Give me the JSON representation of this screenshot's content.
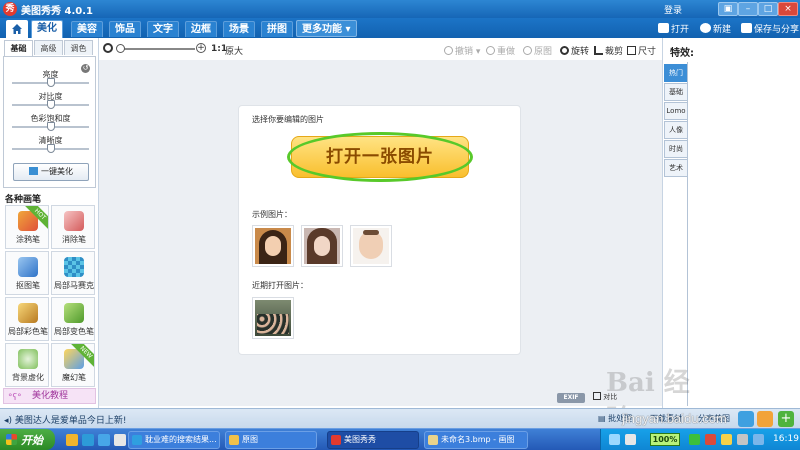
{
  "app": {
    "title": "美图秀秀 4.0.1",
    "login": "登录"
  },
  "main_tabs": [
    {
      "label": "美化",
      "active": true
    },
    {
      "label": "美容"
    },
    {
      "label": "饰品"
    },
    {
      "label": "文字"
    },
    {
      "label": "边框"
    },
    {
      "label": "场景"
    },
    {
      "label": "拼图"
    }
  ],
  "more_tab": "更多功能 ▾",
  "top_actions": {
    "open": "打开",
    "new": "新建",
    "save_share": "保存与分享"
  },
  "toolbar": {
    "ratio": "1:1",
    "original_size": "原大",
    "undo": "撤销",
    "redo": "重做",
    "original": "原图",
    "rotate": "旋转",
    "crop": "裁剪",
    "size": "尺寸"
  },
  "left_panel": {
    "sub_tabs": [
      {
        "label": "基础",
        "active": true
      },
      {
        "label": "高级"
      },
      {
        "label": "调色"
      }
    ],
    "sliders": [
      {
        "label": "亮度",
        "value": 0.5
      },
      {
        "label": "对比度",
        "value": 0.5
      },
      {
        "label": "色彩饱和度",
        "value": 0.5
      },
      {
        "label": "清晰度",
        "value": 0.5
      }
    ],
    "one_click": "一键美化",
    "brush_title": "各种画笔",
    "brushes": [
      {
        "label": "涂鸦笔",
        "badge": ""
      },
      {
        "label": "消除笔",
        "badge": ""
      },
      {
        "label": "抠图笔",
        "badge": ""
      },
      {
        "label": "局部马赛克",
        "badge": ""
      },
      {
        "label": "局部彩色笔",
        "badge": ""
      },
      {
        "label": "局部变色笔",
        "badge": ""
      },
      {
        "label": "背景虚化",
        "badge": ""
      },
      {
        "label": "魔幻笔",
        "badge": ""
      }
    ],
    "tutorial": "美化教程"
  },
  "canvas": {
    "prompt": "选择你要编辑的图片",
    "open_button": "打开一张图片",
    "sample_title": "示例图片：",
    "recent_title": "近期打开图片："
  },
  "canvas_footer": {
    "exif": "EXIF",
    "compare": "对比"
  },
  "right_panel": {
    "title": "特效:",
    "tabs": [
      {
        "label": "热门",
        "active": true
      },
      {
        "label": "基础"
      },
      {
        "label": "Lomo"
      },
      {
        "label": "人像"
      },
      {
        "label": "时尚"
      },
      {
        "label": "艺术"
      }
    ]
  },
  "status_bar": {
    "message": "美图达人是爱单品今日上新!",
    "item1": "批处理",
    "item2": "下载素材",
    "item3": "分享美图"
  },
  "taskbar": {
    "start": "开始",
    "tasks": [
      {
        "label": "耽业难的搜索结果..."
      },
      {
        "label": "原图"
      },
      {
        "label": "美图秀秀",
        "active": true
      },
      {
        "label": "未命名3.bmp - 画图"
      }
    ],
    "battery": "100%",
    "clock": "16:19"
  },
  "watermark": {
    "logo": "Bai 经验",
    "url": "jingyan.baidu.com"
  },
  "colors": {
    "title_blue": "#1666b6",
    "accent_green": "#58c92a",
    "open_yellow": "#f9bf2e"
  }
}
